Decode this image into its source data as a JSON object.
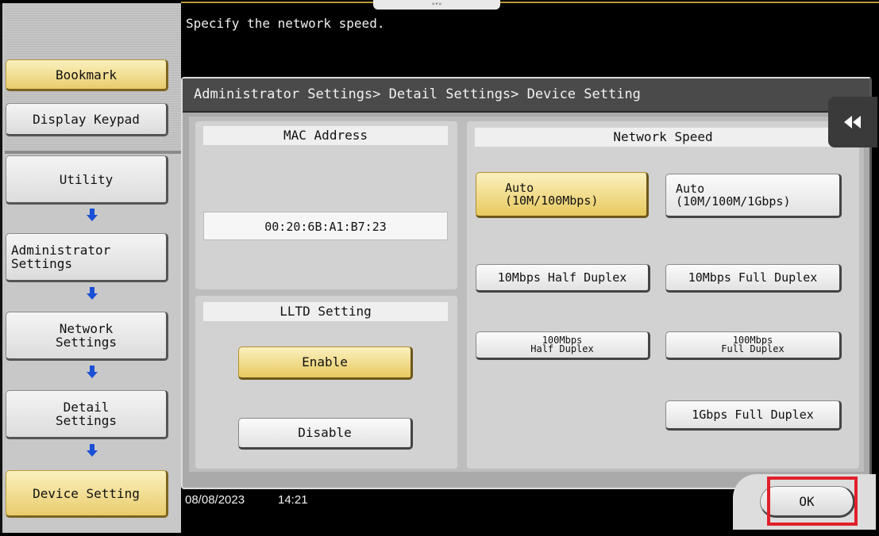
{
  "instruction": "Specify the network speed.",
  "breadcrumb": "Administrator Settings> Detail Settings> Device Setting",
  "sidebar": {
    "bookmark_label": "Bookmark",
    "display_keypad_label": "Display Keypad",
    "nav": [
      {
        "label": "Utility"
      },
      {
        "label": "Administrator\nSettings"
      },
      {
        "label": "Network\nSettings"
      },
      {
        "label": "Detail\nSettings"
      },
      {
        "label": "Device Setting"
      }
    ]
  },
  "mac": {
    "heading": "MAC Address",
    "value": "00:20:6B:A1:B7:23"
  },
  "lltd": {
    "heading": "LLTD Setting",
    "enable_label": "Enable",
    "disable_label": "Disable",
    "selected": "Enable"
  },
  "network_speed": {
    "heading": "Network Speed",
    "options": [
      {
        "label": "Auto\n(10M/100Mbps)",
        "selected": true
      },
      {
        "label": "Auto\n(10M/100M/1Gbps)",
        "selected": false
      },
      {
        "label": "10Mbps Half Duplex",
        "selected": false
      },
      {
        "label": "10Mbps Full Duplex",
        "selected": false
      },
      {
        "label": "100Mbps\nHalf Duplex",
        "selected": false
      },
      {
        "label": "100Mbps\nFull Duplex",
        "selected": false
      },
      {
        "label": "1Gbps Full Duplex",
        "selected": false
      }
    ]
  },
  "footer": {
    "date": "08/08/2023",
    "time": "14:21",
    "ok_label": "OK"
  },
  "collapse_icon": "double-left-arrow-icon",
  "colors": {
    "selected_yellow": "#e8c95f",
    "highlight_red": "#e0202a",
    "nav_arrow_blue": "#1a4fd6"
  }
}
